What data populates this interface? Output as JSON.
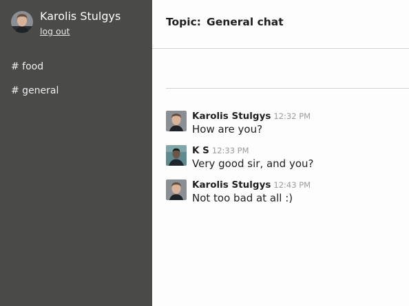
{
  "user": {
    "name": "Karolis Stulgys",
    "logout_label": "log out"
  },
  "channels": [
    {
      "label": "# food"
    },
    {
      "label": "# general"
    }
  ],
  "topic": {
    "label": "Topic:",
    "value": "General chat"
  },
  "messages": [
    {
      "author": "Karolis Stulgys",
      "time": "12:32 PM",
      "text": "How are you?",
      "avatar": "user-avatar-karolis"
    },
    {
      "author": "K S",
      "time": "12:33 PM",
      "text": "Very good sir, and you?",
      "avatar": "user-avatar-ks"
    },
    {
      "author": "Karolis Stulgys",
      "time": "12:43 PM",
      "text": "Not too bad at all :)",
      "avatar": "user-avatar-karolis"
    }
  ],
  "colors": {
    "sidebar_bg": "#4a4a48",
    "main_bg": "#fdfdfd",
    "timestamp": "#9a9a9a"
  }
}
